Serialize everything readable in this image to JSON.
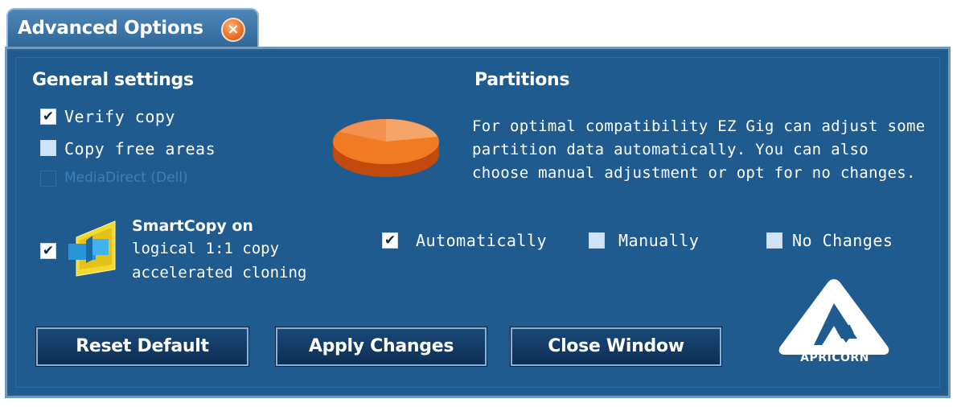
{
  "window": {
    "tab_title": "Advanced Options",
    "close_icon": "close-icon",
    "close_symbol": "×"
  },
  "general": {
    "heading": "General settings",
    "options": [
      {
        "label": "Verify copy",
        "checked": true,
        "enabled": true
      },
      {
        "label": "Copy free areas",
        "checked": false,
        "enabled": true
      },
      {
        "label": "MediaDirect (Dell)",
        "checked": false,
        "enabled": false
      }
    ]
  },
  "smartcopy": {
    "checked": true,
    "icon": "smartcopy-icon",
    "title": "SmartCopy on",
    "line1": "logical 1:1 copy",
    "line2": "accelerated cloning"
  },
  "partitions": {
    "heading": "Partitions",
    "icon": "pie-chart-icon",
    "description": "For optimal compatibility EZ Gig can adjust some partition data automatically. You can also choose manual adjustment or opt for no changes.",
    "options": [
      {
        "label": "Automatically",
        "checked": true
      },
      {
        "label": "Manually",
        "checked": false
      },
      {
        "label": "No Changes",
        "checked": false
      }
    ]
  },
  "buttons": {
    "reset": "Reset Default",
    "apply": "Apply Changes",
    "close": "Close Window"
  },
  "logo": {
    "text": "APRICORN",
    "icon": "apricorn-logo"
  },
  "colors": {
    "panel_bg": "#1f5b8f",
    "accent_orange": "#f07a2a"
  },
  "check_symbol": "✔"
}
